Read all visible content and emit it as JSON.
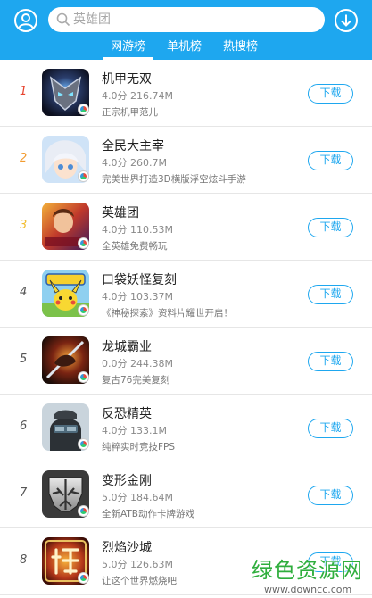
{
  "header": {
    "search": {
      "placeholder": "英雄团"
    },
    "tabs": [
      {
        "label": "网游榜",
        "active": true
      },
      {
        "label": "单机榜",
        "active": false
      },
      {
        "label": "热搜榜",
        "active": false
      }
    ],
    "accent_color": "#1ea7ef"
  },
  "apps": [
    {
      "rank": "1",
      "name": "机甲无双",
      "meta": "4.0分 216.74M",
      "desc": "正宗机甲范儿",
      "button": "下载"
    },
    {
      "rank": "2",
      "name": "全民大主宰",
      "meta": "4.0分 260.7M",
      "desc": "完美世界打造3D横版浮空炫斗手游",
      "button": "下载"
    },
    {
      "rank": "3",
      "name": "英雄团",
      "meta": "4.0分 110.53M",
      "desc": "全英雄免费畅玩",
      "button": "下载"
    },
    {
      "rank": "4",
      "name": "口袋妖怪复刻",
      "meta": "4.0分 103.37M",
      "desc": "《神秘探索》资料片耀世开启！",
      "button": "下载"
    },
    {
      "rank": "5",
      "name": "龙城霸业",
      "meta": "0.0分 244.38M",
      "desc": "复古76完美复刻",
      "button": "下载"
    },
    {
      "rank": "6",
      "name": "反恐精英",
      "meta": "4.0分 133.1M",
      "desc": "纯粹实时竞技FPS",
      "button": "下载"
    },
    {
      "rank": "7",
      "name": "变形金刚",
      "meta": "5.0分 184.64M",
      "desc": "全新ATB动作卡牌游戏",
      "button": "下载"
    },
    {
      "rank": "8",
      "name": "烈焰沙城",
      "meta": "5.0分 126.63M",
      "desc": "让这个世界燃烧吧",
      "button": "下载"
    }
  ],
  "watermark": {
    "main": "绿色资源网",
    "url": "www.downcc.com"
  }
}
